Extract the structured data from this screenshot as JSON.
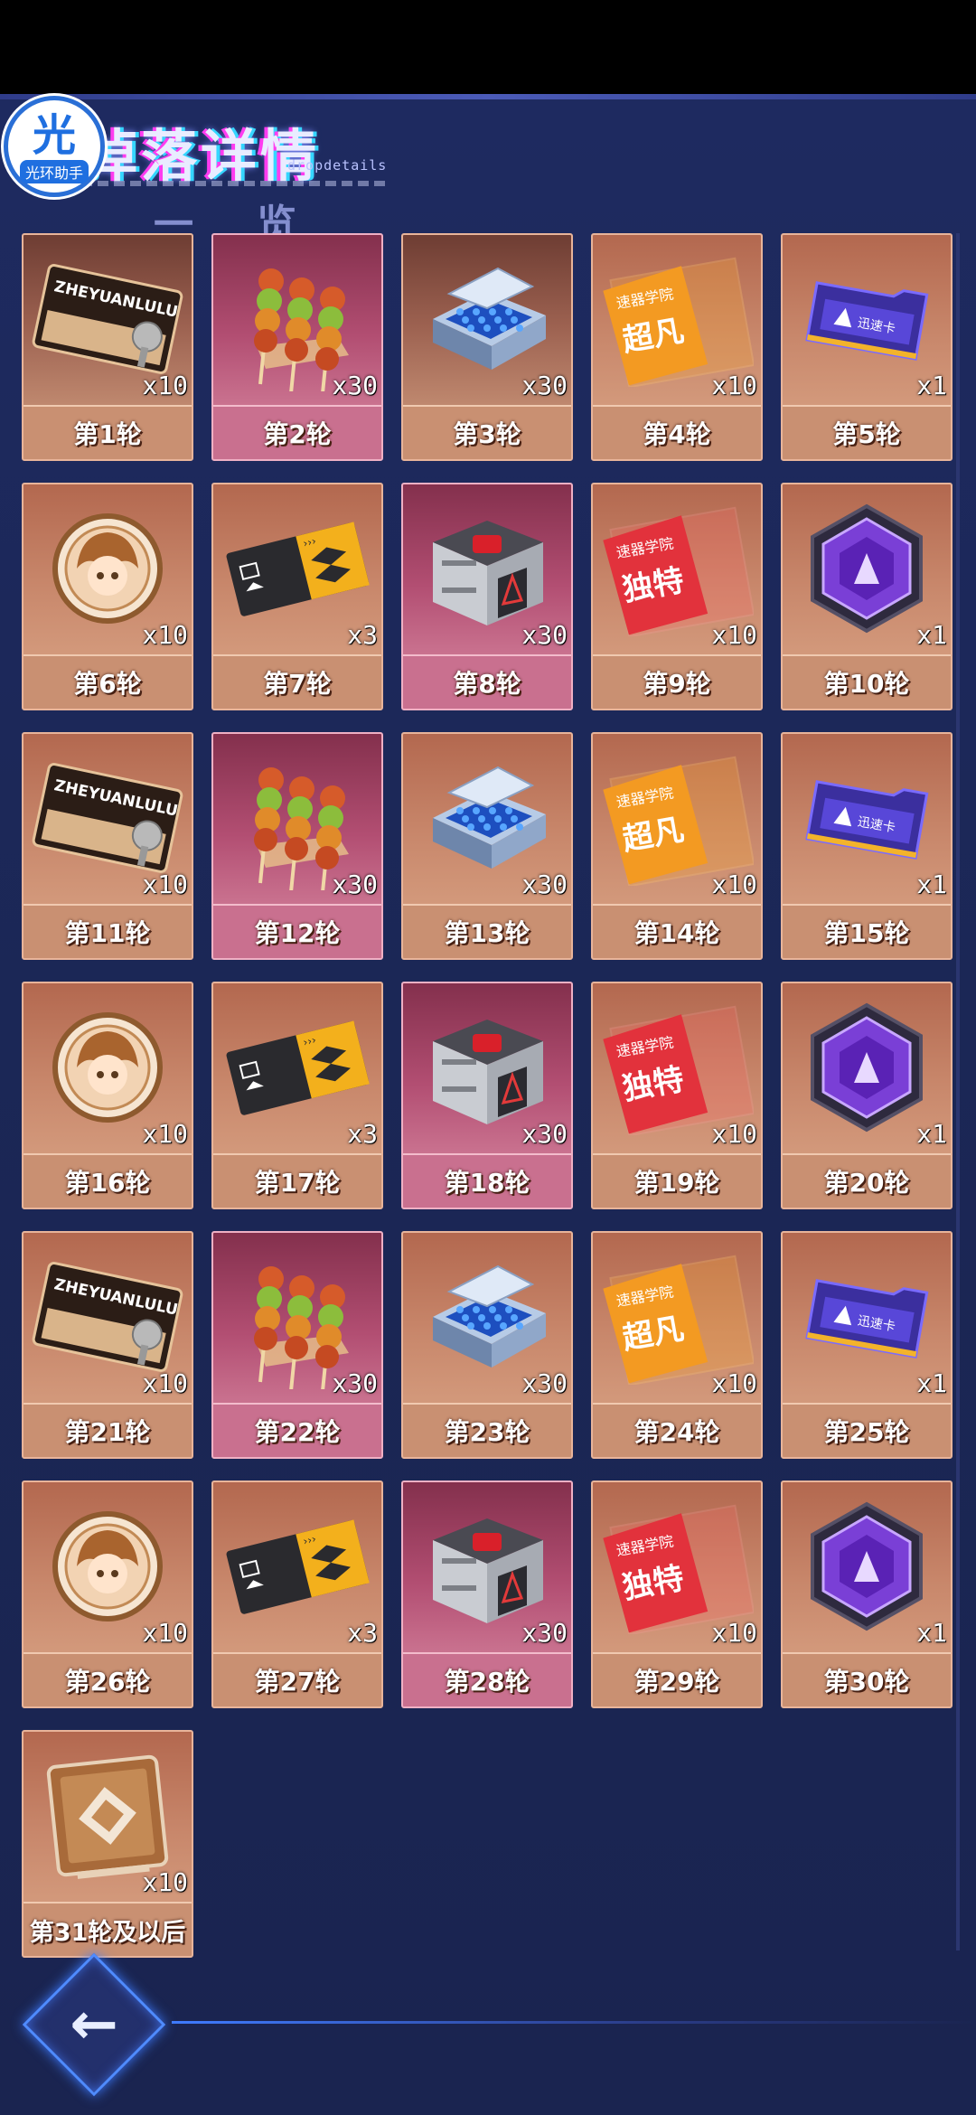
{
  "title": "掉落详情",
  "subtitle": "dropdetails",
  "title_under": "一览",
  "badge": {
    "char": "光",
    "text": "光环助手"
  },
  "items": [
    {
      "label": "第1轮",
      "qty": "x10",
      "icon": "ticket-card-icon",
      "bg": "dark"
    },
    {
      "label": "第2轮",
      "qty": "x30",
      "icon": "skewer-food-icon",
      "bg": "pink"
    },
    {
      "label": "第3轮",
      "qty": "x30",
      "icon": "blue-crystal-case-icon",
      "bg": "dark"
    },
    {
      "label": "第4轮",
      "qty": "x10",
      "icon": "orange-academy-card-icon",
      "bg": "normal"
    },
    {
      "label": "第5轮",
      "qty": "x1",
      "icon": "purple-keycard-icon",
      "bg": "normal"
    },
    {
      "label": "第6轮",
      "qty": "x10",
      "icon": "portrait-coin-icon",
      "bg": "normal"
    },
    {
      "label": "第7轮",
      "qty": "x3",
      "icon": "black-yellow-ticket-icon",
      "bg": "normal"
    },
    {
      "label": "第8轮",
      "qty": "x30",
      "icon": "metal-supply-box-icon",
      "bg": "pink"
    },
    {
      "label": "第9轮",
      "qty": "x10",
      "icon": "red-academy-card-icon",
      "bg": "normal"
    },
    {
      "label": "第10轮",
      "qty": "x1",
      "icon": "purple-hexagon-emblem-icon",
      "bg": "normal"
    },
    {
      "label": "第11轮",
      "qty": "x10",
      "icon": "ticket-card-icon",
      "bg": "normal"
    },
    {
      "label": "第12轮",
      "qty": "x30",
      "icon": "skewer-food-icon",
      "bg": "pink"
    },
    {
      "label": "第13轮",
      "qty": "x30",
      "icon": "blue-crystal-case-icon",
      "bg": "normal"
    },
    {
      "label": "第14轮",
      "qty": "x10",
      "icon": "orange-academy-card-icon",
      "bg": "normal"
    },
    {
      "label": "第15轮",
      "qty": "x1",
      "icon": "purple-keycard-icon",
      "bg": "normal"
    },
    {
      "label": "第16轮",
      "qty": "x10",
      "icon": "portrait-coin-icon",
      "bg": "normal"
    },
    {
      "label": "第17轮",
      "qty": "x3",
      "icon": "black-yellow-ticket-icon",
      "bg": "normal"
    },
    {
      "label": "第18轮",
      "qty": "x30",
      "icon": "metal-supply-box-icon",
      "bg": "pink"
    },
    {
      "label": "第19轮",
      "qty": "x10",
      "icon": "red-academy-card-icon",
      "bg": "normal"
    },
    {
      "label": "第20轮",
      "qty": "x1",
      "icon": "purple-hexagon-emblem-icon",
      "bg": "normal"
    },
    {
      "label": "第21轮",
      "qty": "x10",
      "icon": "ticket-card-icon",
      "bg": "normal"
    },
    {
      "label": "第22轮",
      "qty": "x30",
      "icon": "skewer-food-icon",
      "bg": "pink"
    },
    {
      "label": "第23轮",
      "qty": "x30",
      "icon": "blue-crystal-case-icon",
      "bg": "normal"
    },
    {
      "label": "第24轮",
      "qty": "x10",
      "icon": "orange-academy-card-icon",
      "bg": "normal"
    },
    {
      "label": "第25轮",
      "qty": "x1",
      "icon": "purple-keycard-icon",
      "bg": "normal"
    },
    {
      "label": "第26轮",
      "qty": "x10",
      "icon": "portrait-coin-icon",
      "bg": "normal"
    },
    {
      "label": "第27轮",
      "qty": "x3",
      "icon": "black-yellow-ticket-icon",
      "bg": "normal"
    },
    {
      "label": "第28轮",
      "qty": "x30",
      "icon": "metal-supply-box-icon",
      "bg": "pink"
    },
    {
      "label": "第29轮",
      "qty": "x10",
      "icon": "red-academy-card-icon",
      "bg": "normal"
    },
    {
      "label": "第30轮",
      "qty": "x1",
      "icon": "purple-hexagon-emblem-icon",
      "bg": "normal"
    },
    {
      "label": "第31轮及以后",
      "qty": "x10",
      "icon": "bronze-plate-icon",
      "bg": "normal"
    }
  ],
  "ticket_text": "ZHEYUANLULU",
  "academy_header": "速器学院",
  "orange_card_text": "超凡",
  "red_card_text": "独特",
  "keycard_text": "迅速卡",
  "back_arrow": "←",
  "colors": {
    "background": "#1f2a5c",
    "cell_border": "#e8b49a",
    "accent_blue": "#4f8bff"
  }
}
